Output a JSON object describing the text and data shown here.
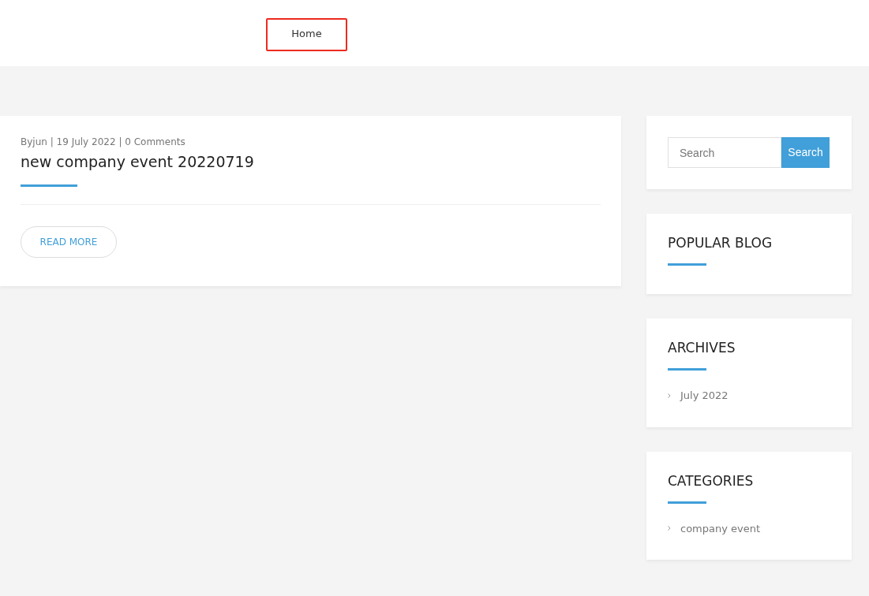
{
  "nav": [
    {
      "label": "Home",
      "highlighted": true
    }
  ],
  "post": {
    "meta": "Byjun | 19 July 2022 | 0 Comments",
    "title": "new company event 20220719",
    "button": "READ MORE"
  },
  "sidebar": [
    {
      "kind": "search",
      "placeholder": "Search",
      "button": "Search"
    },
    {
      "kind": "list",
      "title": "POPULAR BLOG"
    },
    {
      "kind": "list",
      "title": "ARCHIVES",
      "items": [
        "July 2022"
      ]
    },
    {
      "kind": "list",
      "title": "CATEGORIES",
      "items": [
        "company event"
      ]
    }
  ]
}
